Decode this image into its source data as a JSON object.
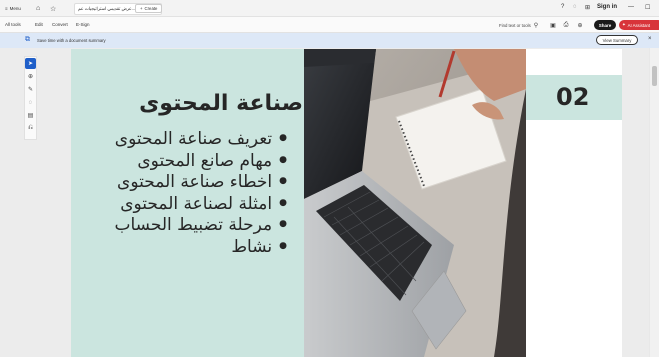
{
  "titlebar": {
    "menu_label": "Menu",
    "tab_title": "عرض تقديمي استراتيجيات عم...",
    "new_tab_label": "Create",
    "sign_in": "Sign in"
  },
  "menubar": {
    "items": [
      "All tools",
      "Edit",
      "Convert",
      "E-Sign"
    ],
    "find_label": "Find text or tools",
    "share_label": "Share",
    "ai_label": "AI Assistant"
  },
  "notice": {
    "text": "Save time with a document summary",
    "view_summary": "View Summary",
    "close": "×"
  },
  "slide": {
    "title": "صناعة المحتوى",
    "bullets": [
      "تعريف صناعة المحتوى",
      "مهام صانع المحتوى",
      "اخطاء صناعة المحتوى",
      "امثلة لصناعة المحتوى",
      "مرحلة تضبيط الحساب",
      "نشاط"
    ],
    "number": "02"
  },
  "colors": {
    "panel": "#cbe5df",
    "accent_blue": "#1f5fc9",
    "ai_red": "#d8343a"
  }
}
